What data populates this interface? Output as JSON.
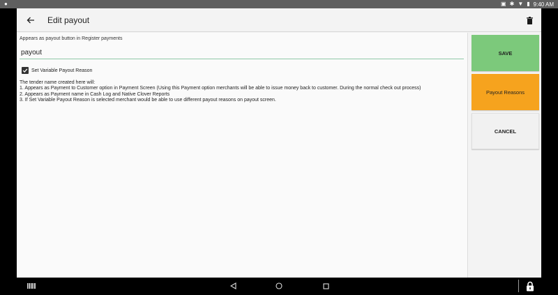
{
  "status_bar": {
    "time": "9:40 AM"
  },
  "toolbar": {
    "title": "Edit payout"
  },
  "form": {
    "hint": "Appears as payout button in Register payments",
    "name_value": "payout",
    "checkbox_label": "Set Variable Payout Reason",
    "checkbox_checked": true
  },
  "info": {
    "intro": "The tender name created here will:",
    "lines": [
      "1. Appears as Payment to Customer option in Payment Screen (Using this Payment option merchants will be able to issue money back to customer. During the normal check out process)",
      "2. Appears as Payment name in Cash Log and Native Clover Reports",
      "3. If Set Variable Payout Reason is selected merchant would be able to use different payout reasons on payout screen."
    ]
  },
  "actions": {
    "save_label": "SAVE",
    "reasons_label": "Payout Reasons",
    "cancel_label": "CANCEL"
  },
  "colors": {
    "save": "#7cc97b",
    "reasons": "#f6a31e",
    "cancel": "#f1f1f1",
    "input_underline": "#8fc9a8"
  },
  "icons": {
    "back": "arrow-left-icon",
    "delete": "trash-icon",
    "check": "check-icon",
    "nav_back": "triangle-back-icon",
    "nav_home": "circle-home-icon",
    "nav_recents": "square-recents-icon",
    "barcode": "barcode-icon",
    "lock": "lock-icon"
  }
}
